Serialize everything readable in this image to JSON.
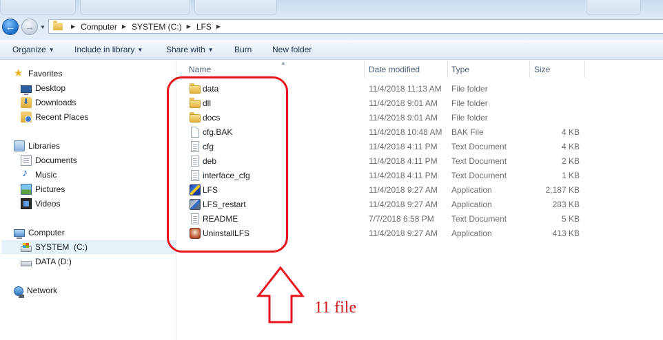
{
  "window": {
    "background_tab_titles": [
      "",
      "",
      "",
      ""
    ]
  },
  "address_bar": {
    "breadcrumbs": [
      "Computer",
      "SYSTEM (C:)",
      "LFS"
    ]
  },
  "command_bar": {
    "organize": "Organize",
    "include_in_library": "Include in library",
    "share_with": "Share with",
    "burn": "Burn",
    "new_folder": "New folder"
  },
  "navigation": {
    "favorites": {
      "label": "Favorites",
      "items": [
        "Desktop",
        "Downloads",
        "Recent Places"
      ]
    },
    "libraries": {
      "label": "Libraries",
      "items": [
        "Documents",
        "Music",
        "Pictures",
        "Videos"
      ]
    },
    "computer": {
      "label": "Computer",
      "drives": [
        "SYSTEM  (C:)",
        "DATA (D:)"
      ],
      "selected": "SYSTEM  (C:)"
    },
    "network": {
      "label": "Network"
    }
  },
  "file_list": {
    "columns": [
      "Name",
      "Date modified",
      "Type",
      "Size"
    ],
    "sort_column": "Name",
    "rows": [
      {
        "name": "data",
        "date": "11/4/2018 11:13 AM",
        "type": "File folder",
        "size": "",
        "icon": "folder-icon"
      },
      {
        "name": "dll",
        "date": "11/4/2018 9:01 AM",
        "type": "File folder",
        "size": "",
        "icon": "folder-icon"
      },
      {
        "name": "docs",
        "date": "11/4/2018 9:01 AM",
        "type": "File folder",
        "size": "",
        "icon": "folder-icon"
      },
      {
        "name": "cfg.BAK",
        "date": "11/4/2018 10:48 AM",
        "type": "BAK File",
        "size": "4 KB",
        "icon": "blank-file-icon"
      },
      {
        "name": "cfg",
        "date": "11/4/2018 4:11 PM",
        "type": "Text Document",
        "size": "4 KB",
        "icon": "text-file-icon"
      },
      {
        "name": "deb",
        "date": "11/4/2018 4:11 PM",
        "type": "Text Document",
        "size": "2 KB",
        "icon": "text-file-icon"
      },
      {
        "name": "interface_cfg",
        "date": "11/4/2018 4:11 PM",
        "type": "Text Document",
        "size": "1 KB",
        "icon": "text-file-icon"
      },
      {
        "name": "LFS",
        "date": "11/4/2018 9:27 AM",
        "type": "Application",
        "size": "2,187 KB",
        "icon": "lfs-app-icon"
      },
      {
        "name": "LFS_restart",
        "date": "11/4/2018 9:27 AM",
        "type": "Application",
        "size": "283 KB",
        "icon": "lfs-restart-app-icon"
      },
      {
        "name": "README",
        "date": "7/7/2018 6:58 PM",
        "type": "Text Document",
        "size": "5 KB",
        "icon": "text-file-icon"
      },
      {
        "name": "UninstallLFS",
        "date": "11/4/2018 9:27 AM",
        "type": "Application",
        "size": "413 KB",
        "icon": "uninstaller-icon"
      }
    ]
  },
  "annotation": {
    "text": "11 file",
    "color": "#e8131b"
  },
  "colors": {
    "accent_selection": "#e5f3fb",
    "command_text": "#1e3251",
    "secondary_text": "#6d6d6d"
  }
}
